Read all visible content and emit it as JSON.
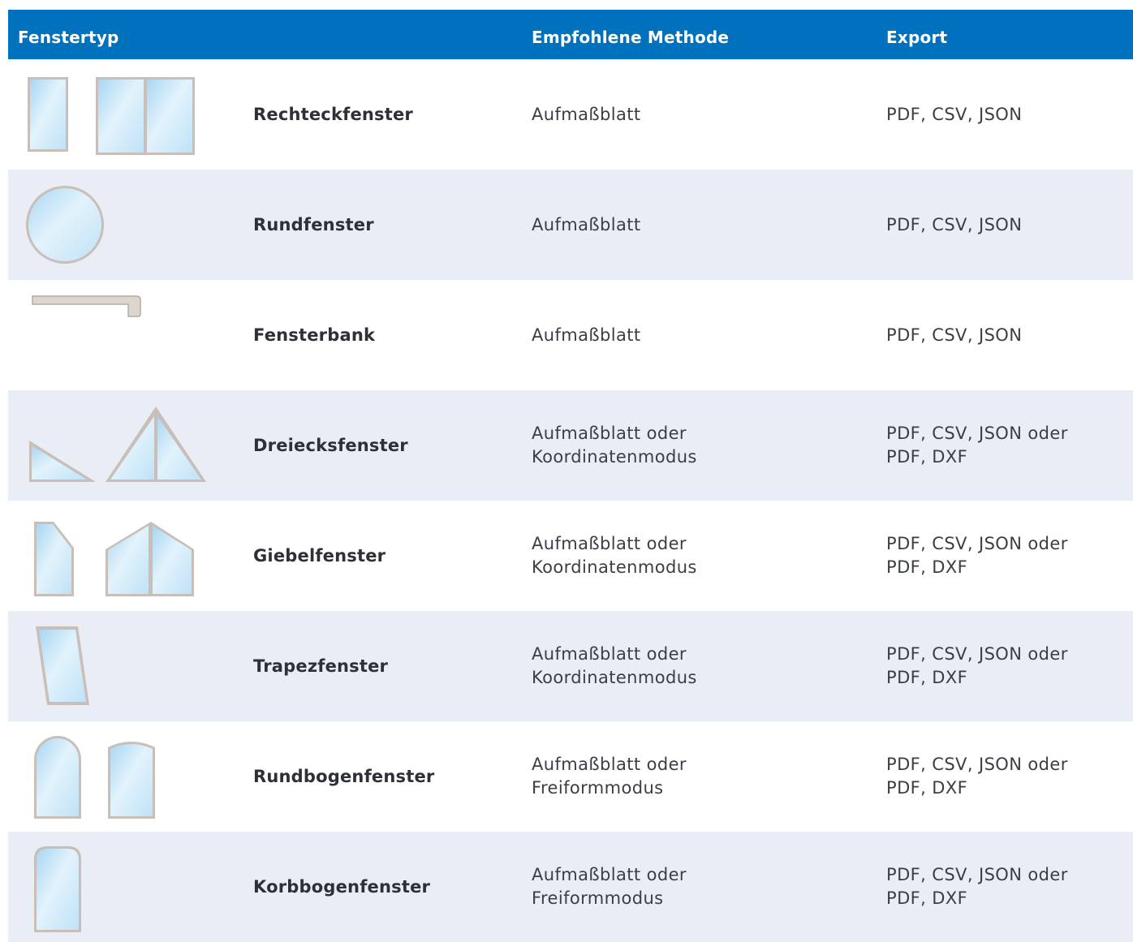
{
  "header": {
    "col_type": "Fenstertyp",
    "col_method": "Empfohlene Methode",
    "col_export": "Export"
  },
  "colors": {
    "header_bg": "#0071bc",
    "row_shaded": "#e9edf5",
    "frame": "#c9bfb8",
    "glass": "#c8e6f7"
  },
  "rows": [
    {
      "icon": "rectangle-window-icon",
      "name": "Rechteckfenster",
      "method1": "Aufmaßblatt",
      "method2": "",
      "export1": "PDF, CSV, JSON",
      "export2": ""
    },
    {
      "icon": "round-window-icon",
      "name": "Rundfenster",
      "method1": "Aufmaßblatt",
      "method2": "",
      "export1": "PDF, CSV, JSON",
      "export2": ""
    },
    {
      "icon": "window-sill-icon",
      "name": "Fensterbank",
      "method1": "Aufmaßblatt",
      "method2": "",
      "export1": "PDF, CSV, JSON",
      "export2": ""
    },
    {
      "icon": "triangle-window-icon",
      "name": "Dreiecksfenster",
      "method1": "Aufmaßblatt oder",
      "method2": "Koordinatenmodus",
      "export1": "PDF, CSV, JSON oder",
      "export2": "PDF, DXF"
    },
    {
      "icon": "gable-window-icon",
      "name": "Giebelfenster",
      "method1": "Aufmaßblatt oder",
      "method2": "Koordinatenmodus",
      "export1": "PDF, CSV, JSON oder",
      "export2": "PDF, DXF"
    },
    {
      "icon": "trapezoid-window-icon",
      "name": "Trapezfenster",
      "method1": "Aufmaßblatt oder",
      "method2": "Koordinatenmodus",
      "export1": "PDF, CSV, JSON oder",
      "export2": "PDF, DXF"
    },
    {
      "icon": "round-arch-window-icon",
      "name": "Rundbogenfenster",
      "method1": "Aufmaßblatt oder",
      "method2": "Freiformmodus",
      "export1": "PDF, CSV, JSON oder",
      "export2": "PDF, DXF"
    },
    {
      "icon": "basket-arch-window-icon",
      "name": "Korbbogenfenster",
      "method1": "Aufmaßblatt oder",
      "method2": "Freiformmodus",
      "export1": "PDF, CSV, JSON oder",
      "export2": "PDF, DXF"
    }
  ]
}
